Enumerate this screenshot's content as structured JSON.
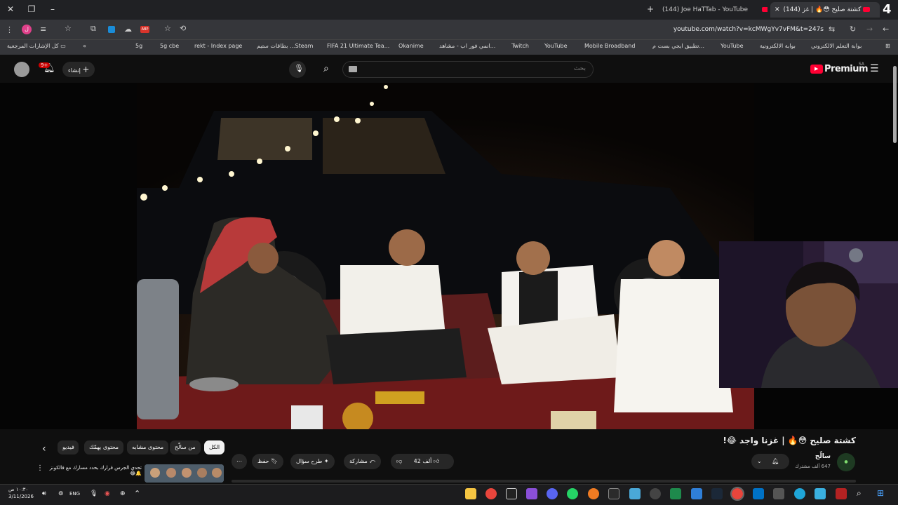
{
  "browser": {
    "tabs": [
      {
        "title": "(144) كشتة صليح 😳🔥 | غز",
        "active": true
      },
      {
        "title": "(144) Joe HaTTab - YouTube",
        "active": false
      }
    ],
    "url": "youtube.com/watch?v=kcMWgYv7vFM&t=247s",
    "profile_initial": "ل",
    "window_number": "4"
  },
  "bookmarks": [
    "بوابة التعلم الالكتروني",
    "بوابة الالكترونية",
    "YouTube",
    "تطبيق ايجي بست م...",
    "Mobile Broadband",
    "YouTube",
    "Twitch",
    "انمي فور اب - مشاهد...",
    "Okanime",
    "FIFA 21 Ultimate Tea...",
    "بطاقات ستيم ...Steam",
    "rekt - Index page",
    "5g cbe",
    "5g"
  ],
  "bookmarks_folder": "كل الإشارات المرجعية",
  "youtube": {
    "logo_text": "Premium",
    "logo_sup": "SA",
    "search_placeholder": "بحث",
    "create_label": "إنشاء",
    "notif_count": "9+"
  },
  "video": {
    "title": "كشتة صليح 😳🔥 | غزنا واجد 😂!",
    "channel_name": "سالّح",
    "subscribers": "647 ألف مشترك",
    "likes": "42 ألف",
    "share_label": "مشاركة",
    "ask_label": "طرح سؤال",
    "save_label": "حفظ"
  },
  "chips": [
    "الكل",
    "من سالّح",
    "محتوى مشابه",
    "محتوى يهمّك",
    "فيديو"
  ],
  "recommended": {
    "title": "تحدي الجرس قرارك بحدد مسارك مع فالكونز 🔔😂"
  },
  "taskbar": {
    "time": "١٠:٣٠ ص",
    "date": "3/11/2026",
    "lang": "ENG"
  },
  "colors": {
    "accent": "#ff0033",
    "bg": "#0f0f0f",
    "chrome": "#35363a"
  }
}
